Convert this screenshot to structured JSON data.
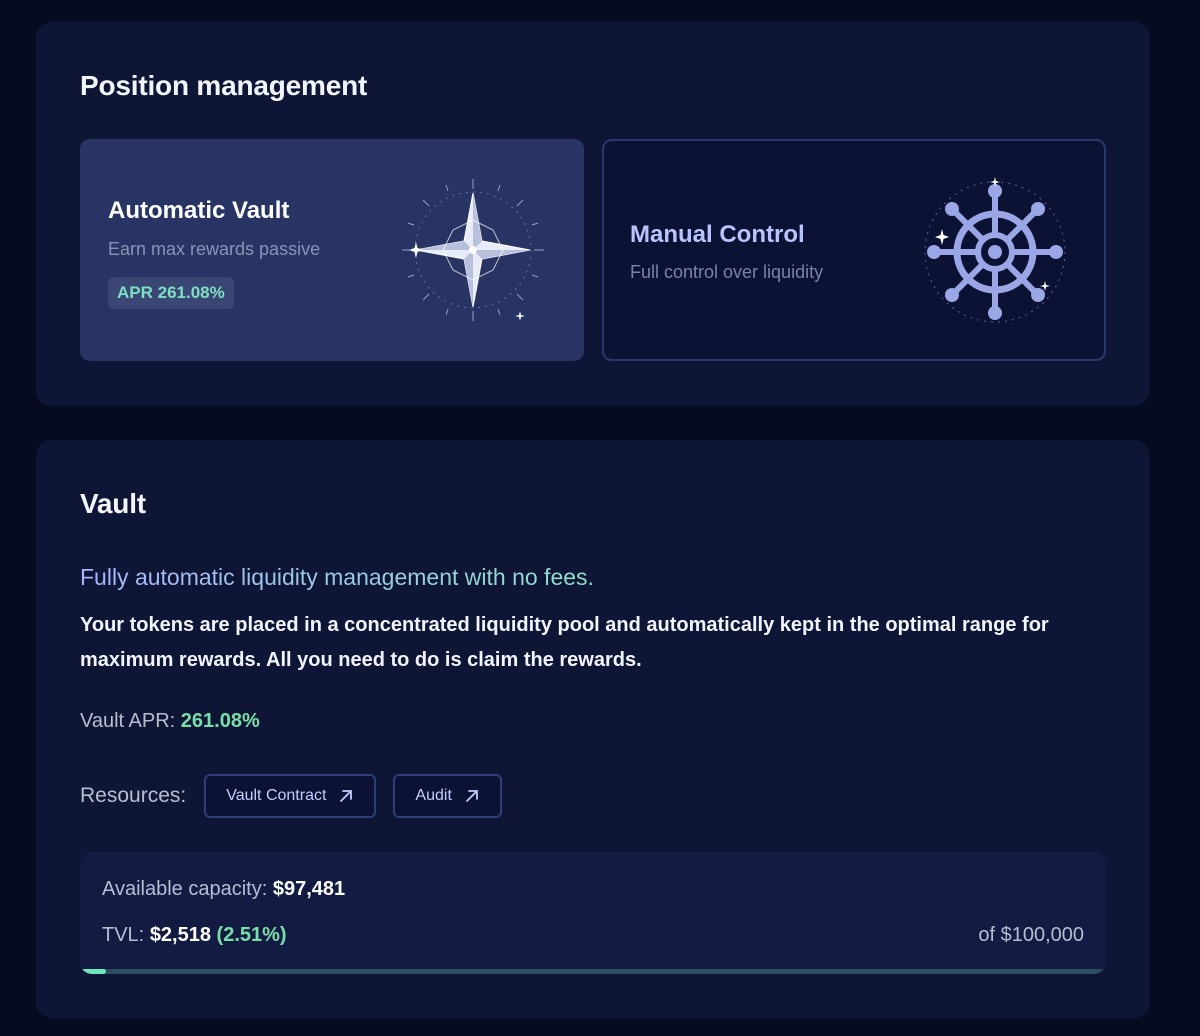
{
  "position_management": {
    "title": "Position management",
    "options": [
      {
        "title": "Automatic Vault",
        "subtitle": "Earn max rewards passive",
        "badge": "APR 261.08%",
        "icon": "compass-star-icon",
        "selected": true
      },
      {
        "title": "Manual Control",
        "subtitle": "Full control over liquidity",
        "icon": "ship-wheel-icon",
        "selected": false
      }
    ]
  },
  "vault": {
    "title": "Vault",
    "headline": "Fully automatic liquidity management with no fees.",
    "description": "Your tokens are placed in a concentrated liquidity pool and automatically kept in the optimal range for maximum rewards. All you need to do is claim the rewards.",
    "apr_label": "Vault APR:",
    "apr_value": "261.08%",
    "resources_label": "Resources:",
    "resources": [
      {
        "label": "Vault Contract",
        "icon": "external-link-icon"
      },
      {
        "label": "Audit",
        "icon": "external-link-icon"
      }
    ],
    "capacity": {
      "available_label": "Available capacity:",
      "available_value": "$97,481",
      "tvl_label": "TVL:",
      "tvl_value": "$2,518",
      "tvl_percent": "(2.51%)",
      "of_total": "of $100,000",
      "fill_fraction": 0.0251
    }
  },
  "colors": {
    "background": "#070b22",
    "panel": "#0f1535",
    "selected_card": "#283564",
    "accent_green": "#79dfa9",
    "accent_blue": "#b9c4ff"
  }
}
